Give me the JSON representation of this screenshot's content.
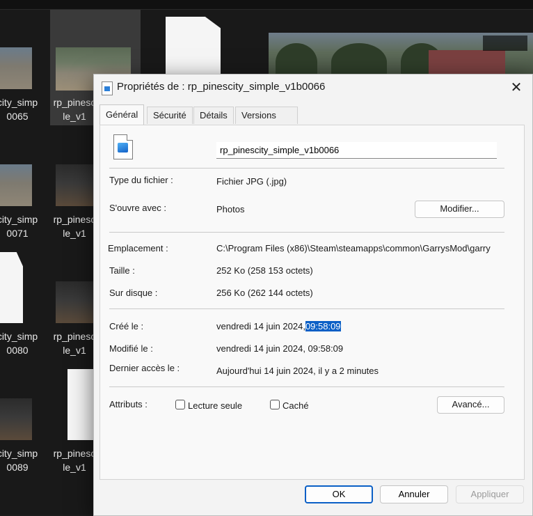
{
  "explorer": {
    "tiles": [
      {
        "line1": "city_simp",
        "line2": "0065"
      },
      {
        "line1": "rp_pinesc",
        "line2": "le_v1"
      },
      {
        "line1": "city_simp",
        "line2": "0071"
      },
      {
        "line1": "rp_pinesc",
        "line2": "le_v1"
      },
      {
        "line1": "city_simp",
        "line2": "0080"
      },
      {
        "line1": "rp_pinesc",
        "line2": "le_v1"
      },
      {
        "line1": "city_simp",
        "line2": "0089"
      },
      {
        "line1": "rp_pinesc",
        "line2": "le_v1"
      }
    ]
  },
  "dialog": {
    "title": "Propriétés de : rp_pinescity_simple_v1b0066",
    "close_glyph": "✕",
    "tabs": [
      "Général",
      "Sécurité",
      "Détails",
      "Versions précédentes"
    ],
    "active_tab": "Général",
    "file_name": "rp_pinescity_simple_v1b0066",
    "type_label": "Type du fichier :",
    "type_value": "Fichier JPG (.jpg)",
    "opens_label": "S'ouvre avec :",
    "opens_value": "Photos",
    "modify_button": "Modifier...",
    "location_label": "Emplacement :",
    "location_value": "C:\\Program Files (x86)\\Steam\\steamapps\\common\\GarrysMod\\garry",
    "size_label": "Taille :",
    "size_value": "252 Ko (258 153 octets)",
    "disk_label": "Sur disque :",
    "disk_value": "256 Ko (262 144 octets)",
    "created_label": "Créé le :",
    "created_date": "vendredi 14 juin 2024,",
    "created_time": "09:58:09",
    "modified_label": "Modifié le :",
    "modified_value": "vendredi 14 juin 2024, 09:58:09",
    "accessed_label": "Dernier accès le :",
    "accessed_value": "Aujourd'hui 14 juin 2024, il y a 2 minutes",
    "attributes_label": "Attributs :",
    "readonly_label": "Lecture seule",
    "hidden_label": "Caché",
    "advanced_button": "Avancé...",
    "ok_button": "OK",
    "cancel_button": "Annuler",
    "apply_button": "Appliquer",
    "highlight_color": "#0a5fc6"
  }
}
